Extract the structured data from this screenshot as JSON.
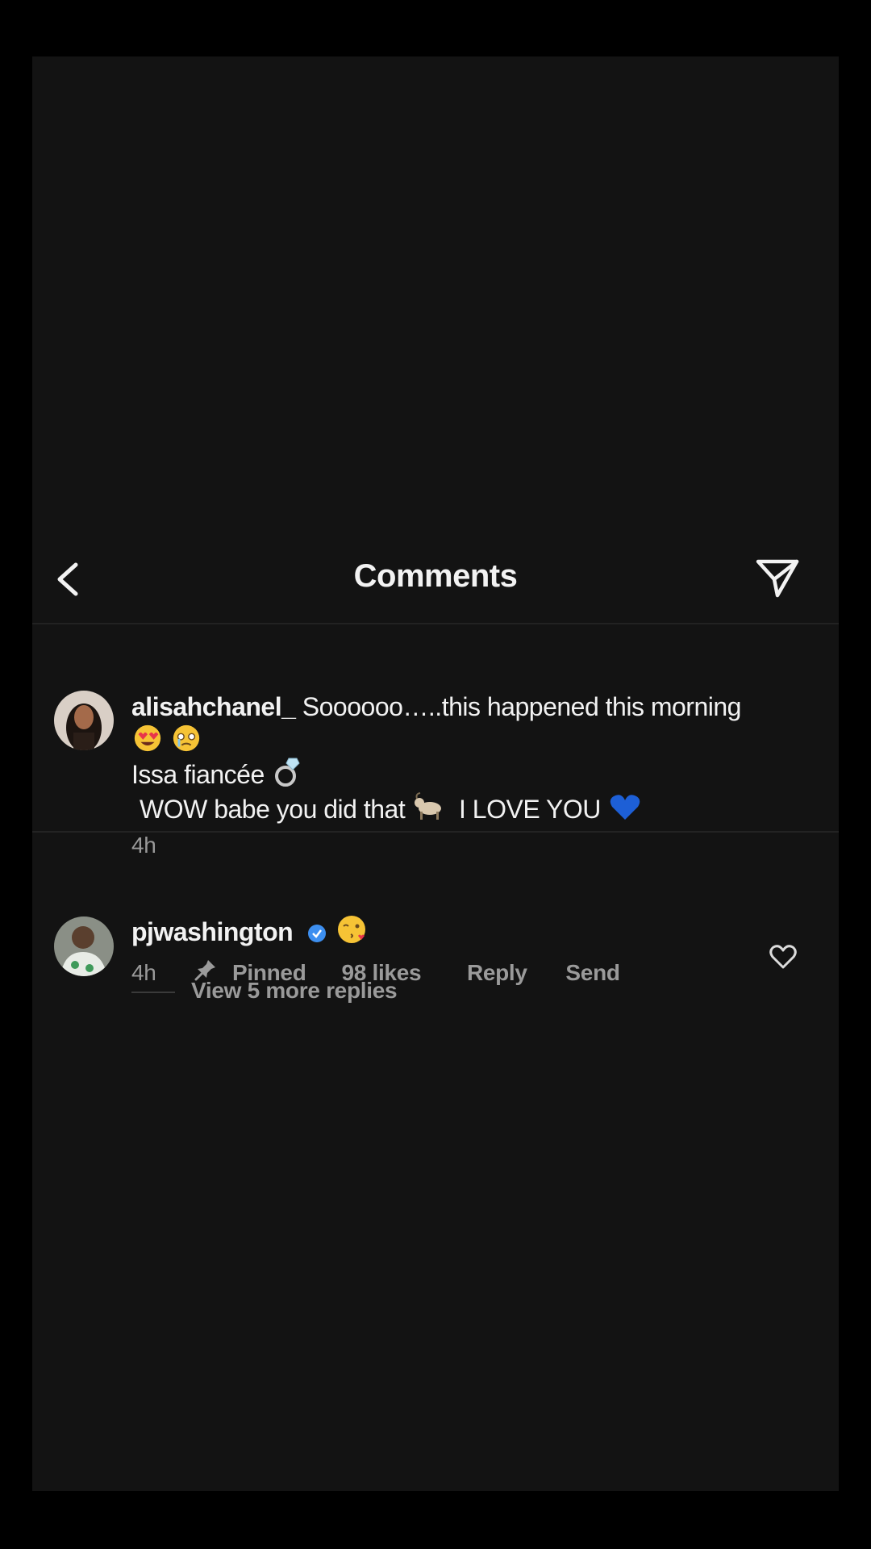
{
  "header": {
    "title": "Comments",
    "back_icon": "chevron-left-icon",
    "share_icon": "paper-plane-icon"
  },
  "caption": {
    "username": "alisahchanel_",
    "text_line1": "Soooooo…..this happened this morning",
    "emojis_line2": [
      "heart-eyes-emoji",
      "crying-face-emoji"
    ],
    "text_line3": "Issa fiancée",
    "emoji_line3": "ring-emoji",
    "text_line4a": "WOW babe you did that",
    "emoji_line4a": "goat-emoji",
    "text_line4b": "I LOVE YOU",
    "emoji_line4b": "blue-heart-emoji",
    "time": "4h"
  },
  "comment": {
    "username": "pjwashington",
    "verified_icon": "verified-badge-icon",
    "emoji": "kissing-face-emoji",
    "time": "4h",
    "pinned_label": "Pinned",
    "likes": "98 likes",
    "reply_label": "Reply",
    "send_label": "Send",
    "like_icon": "heart-outline-icon"
  },
  "replies": {
    "label": "View 5 more replies"
  },
  "colors": {
    "background": "#131313",
    "outer": "#000000",
    "text": "#f2f2f2",
    "secondary_text": "#9a9a9a",
    "verified_blue": "#3d8ff0"
  }
}
